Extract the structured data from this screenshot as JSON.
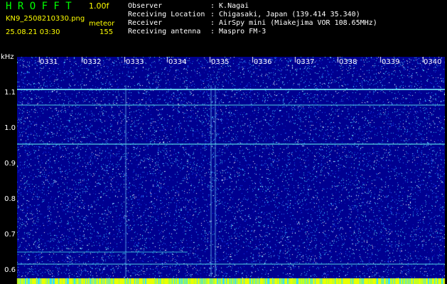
{
  "header": {
    "title": "H R O F F T",
    "version": "1.00f",
    "filename": "KN9_2508210330.png",
    "mode": "meteor",
    "datetime": "25.08.21 03:30",
    "count": "155",
    "observer_label": "Observer",
    "observer_value": ": K.Nagai",
    "location_label": "Receiving Location",
    "location_value": ": Chigasaki, Japan (139.414 35.340)",
    "receiver_label": "Receiver",
    "receiver_value": ": AirSpy mini (Miakejima VOR 108.65MHz)",
    "antenna_label": "Receiving antenna",
    "antenna_value": ": Maspro FM-3"
  },
  "axis": {
    "unit": "kHz",
    "y_ticks": [
      "1.1",
      "1.0",
      "0.9",
      "0.8",
      "0.7",
      "0.6"
    ],
    "time_ticks": [
      "0331",
      "0332",
      "0333",
      "0334",
      "0335",
      "0336",
      "0337",
      "0338",
      "0339",
      "0340"
    ]
  },
  "colors": {
    "background": "#000000",
    "plot": "#00008c",
    "title": "#00ff00",
    "accent": "#ffff00",
    "echo": "#00e0e0"
  }
}
